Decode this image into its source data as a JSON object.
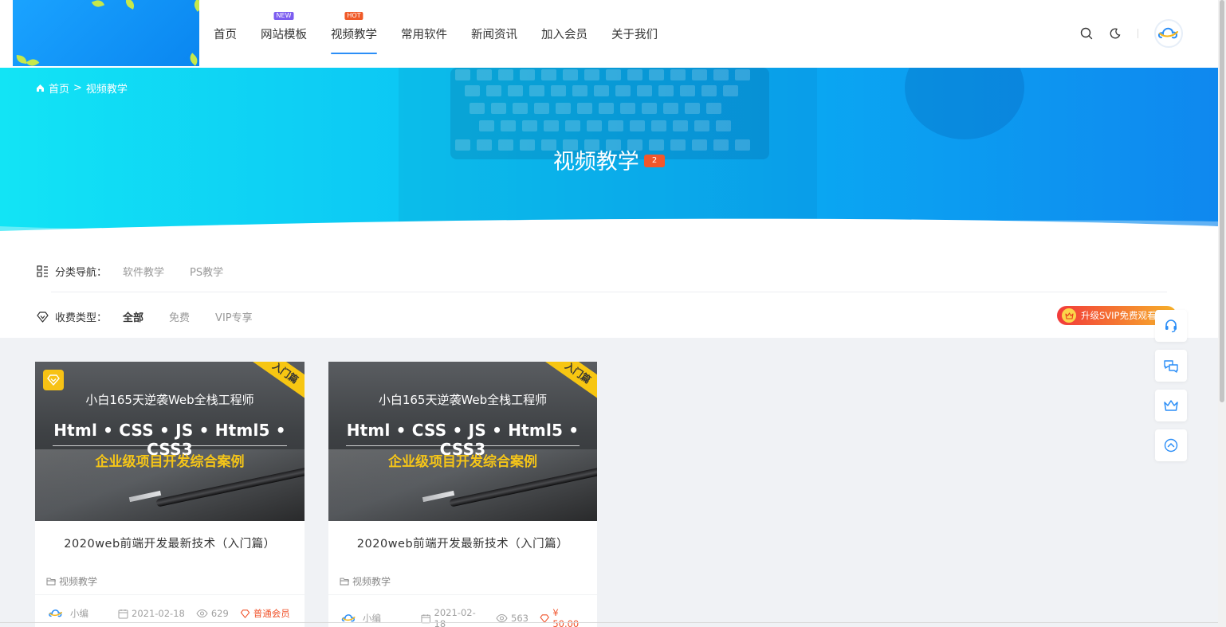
{
  "nav": {
    "items": [
      {
        "label": "首页",
        "badge": ""
      },
      {
        "label": "网站模板",
        "badge": "NEW"
      },
      {
        "label": "视频教学",
        "badge": "HOT",
        "active": true
      },
      {
        "label": "常用软件",
        "badge": ""
      },
      {
        "label": "新闻资讯",
        "badge": ""
      },
      {
        "label": "加入会员",
        "badge": ""
      },
      {
        "label": "关于我们",
        "badge": ""
      }
    ]
  },
  "header_icons": [
    "search-icon",
    "moon-icon",
    "avatar"
  ],
  "breadcrumb": {
    "home": "首页",
    "separator": ">",
    "current": "视频教学"
  },
  "banner": {
    "title": "视频教学",
    "count": "2"
  },
  "filter": {
    "category": {
      "label": "分类导航：",
      "options": [
        "软件教学",
        "PS教学"
      ]
    },
    "fee": {
      "label": "收费类型：",
      "options": [
        "全部",
        "免费",
        "VIP专享"
      ],
      "selected": "全部"
    },
    "svip_button": "升级SVIP免费观看"
  },
  "cards": [
    {
      "thumb": {
        "corner": "入门篇",
        "line1": "小白165天逆袭Web全栈工程师",
        "line2": "Html • CSS • JS • Html5 • CSS3",
        "line3": "企业级项目开发综合案例",
        "vip_mark": true
      },
      "title": "2020web前端开发最新技术（入门篇）",
      "category": "视频教学",
      "author": "小编",
      "date": "2021-02-18",
      "views": "629",
      "price": "普通会员"
    },
    {
      "thumb": {
        "corner": "入门篇",
        "line1": "小白165天逆袭Web全栈工程师",
        "line2": "Html • CSS • JS • Html5 • CSS3",
        "line3": "企业级项目开发综合案例",
        "vip_mark": false
      },
      "title": "2020web前端开发最新技术（入门篇）",
      "category": "视频教学",
      "author": "小编",
      "date": "2021-02-18",
      "views": "563",
      "price": "¥ 50.00"
    }
  ],
  "sidebar": [
    "headset-icon",
    "chat-icon",
    "crown-icon",
    "back-to-top-icon"
  ],
  "colors": {
    "accent": "#2b8ef7",
    "hot": "#f05a28",
    "new": "#7b5cf0",
    "price": "#f0522a",
    "corner": "#f7c612"
  }
}
